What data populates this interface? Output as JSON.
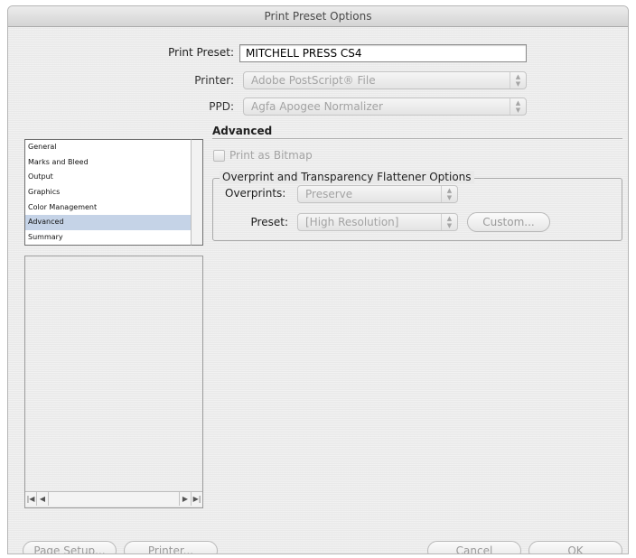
{
  "window": {
    "title": "Print Preset Options"
  },
  "print_preset": {
    "label": "Print Preset:",
    "value": "MITCHELL PRESS CS4"
  },
  "printer": {
    "label": "Printer:",
    "value": "Adobe PostScript® File"
  },
  "ppd": {
    "label": "PPD:",
    "value": "Agfa Apogee Normalizer"
  },
  "categories": {
    "items": [
      {
        "label": "General"
      },
      {
        "label": "Marks and Bleed"
      },
      {
        "label": "Output"
      },
      {
        "label": "Graphics"
      },
      {
        "label": "Color Management"
      },
      {
        "label": "Advanced"
      },
      {
        "label": "Summary"
      }
    ],
    "selected": "Advanced"
  },
  "advanced": {
    "title": "Advanced",
    "print_as_bitmap": {
      "label": "Print as Bitmap",
      "checked": false,
      "enabled": false
    },
    "flattener_group": {
      "title": "Overprint and Transparency Flattener Options",
      "overprints": {
        "label": "Overprints:",
        "value": "Preserve"
      },
      "preset": {
        "label": "Preset:",
        "value": "[High Resolution]"
      },
      "custom_button": "Custom..."
    }
  },
  "footer": {
    "page_setup": "Page Setup...",
    "printer": "Printer...",
    "cancel": "Cancel",
    "ok": "OK"
  },
  "icons": {
    "popup_arrows": "updown-arrows-icon",
    "scroll_first": "first-arrow-icon",
    "scroll_prev": "left-arrow-icon",
    "scroll_next": "right-arrow-icon",
    "scroll_last": "last-arrow-icon"
  },
  "colors": {
    "selection": "#c5d3e7",
    "disabled_text": "#a3a3a3"
  }
}
